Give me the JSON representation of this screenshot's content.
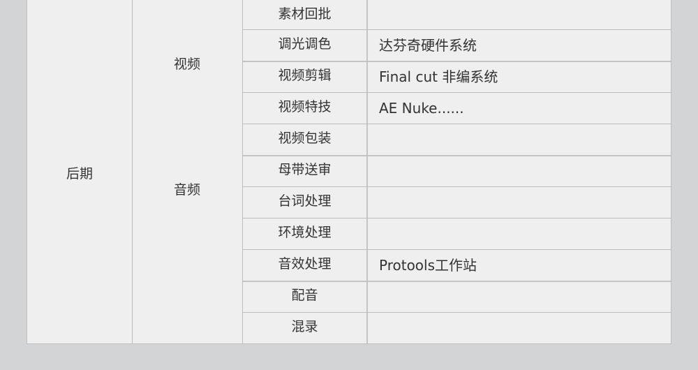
{
  "stage": "后期",
  "groups": [
    "视频",
    "音频"
  ],
  "rows": [
    {
      "task": "素材回批",
      "tool": ""
    },
    {
      "task": "调光调色",
      "tool": "达芬奇硬件系统"
    },
    {
      "task": "视频剪辑",
      "tool": "Final cut 非编系统"
    },
    {
      "task": "视频特技",
      "tool": "AE Nuke......"
    },
    {
      "task": "视频包装",
      "tool": ""
    },
    {
      "task": "母带送审",
      "tool": ""
    },
    {
      "task": "台词处理",
      "tool": ""
    },
    {
      "task": "环境处理",
      "tool": ""
    },
    {
      "task": "音效处理",
      "tool": "Protools工作站"
    },
    {
      "task": "配音",
      "tool": ""
    },
    {
      "task": "混录",
      "tool": ""
    }
  ]
}
